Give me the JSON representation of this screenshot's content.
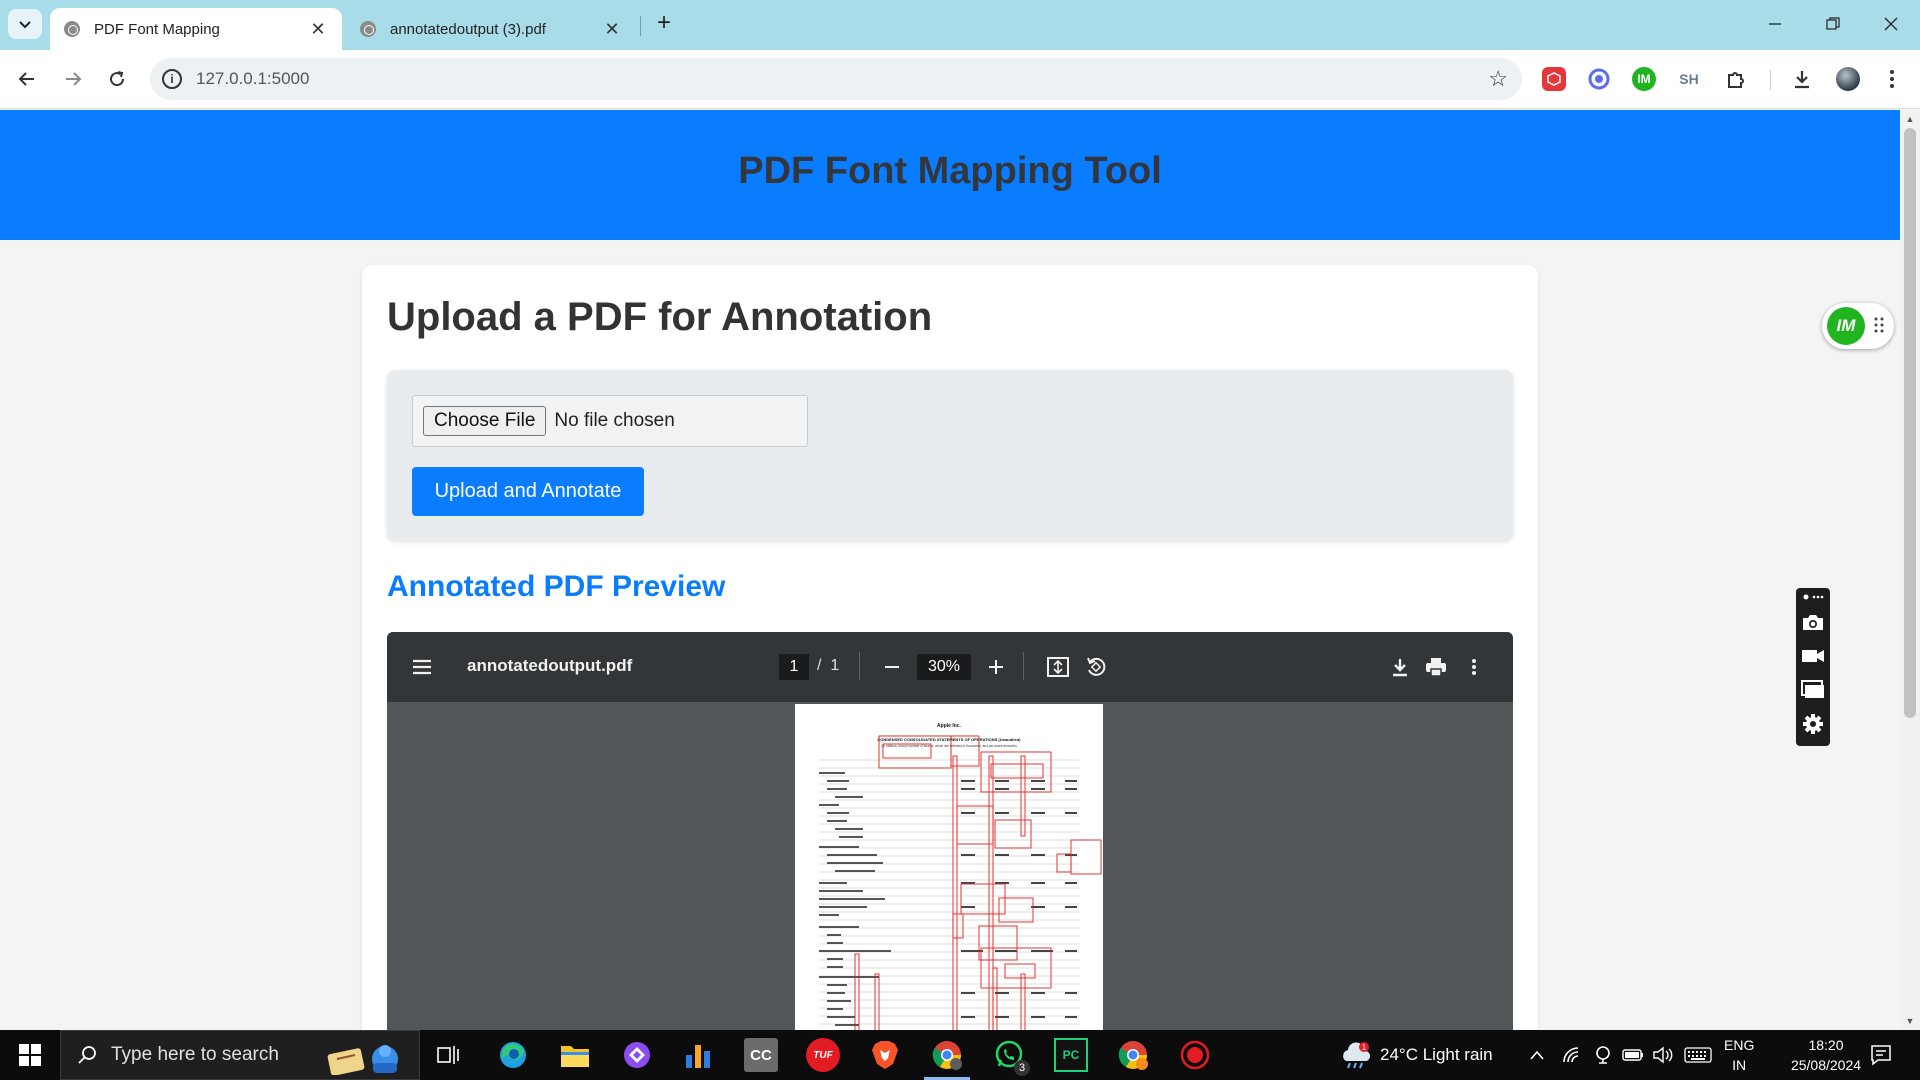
{
  "browser": {
    "tabs": [
      {
        "title": "PDF Font Mapping",
        "active": true
      },
      {
        "title": "annotatedoutput (3).pdf",
        "active": false
      }
    ],
    "url": "127.0.0.1:5000",
    "extensions": [
      {
        "name": "red-cube-extension-icon",
        "color": "#e5373b"
      },
      {
        "name": "blue-swirl-extension-icon",
        "color": "#5b6cf0"
      },
      {
        "name": "im-extension-icon",
        "label": "IM",
        "color": "#21b421"
      },
      {
        "name": "sh-extension-icon",
        "label": "SH",
        "color": "#6b7c93"
      }
    ]
  },
  "page": {
    "header_title": "PDF Font Mapping Tool",
    "upload_heading": "Upload a PDF for Annotation",
    "choose_file_label": "Choose File",
    "file_status": "No file chosen",
    "submit_label": "Upload and Annotate",
    "preview_heading": "Annotated PDF Preview"
  },
  "pdf_viewer": {
    "filename": "annotatedoutput.pdf",
    "current_page": "1",
    "page_separator": "/",
    "total_pages": "1",
    "zoom": "30%"
  },
  "pdf_document": {
    "company": "Apple Inc.",
    "statement_title": "CONDENSED CONSOLIDATED STATEMENTS OF OPERATIONS (Unaudited)",
    "statement_subtitle": "(In millions, except number of shares, which are reflected in thousands, and per-share amounts)"
  },
  "side_tools": {
    "im_badge_label": "IM"
  },
  "taskbar": {
    "search_placeholder": "Type here to search",
    "weather": "24°C  Light rain",
    "language": "ENG",
    "region": "IN",
    "time": "18:20",
    "date": "25/08/2024",
    "whatsapp_badge": "3",
    "notification_count": "1",
    "app_labels": {
      "cc": "CC",
      "tuf": "TUF",
      "pc": "PC"
    }
  },
  "colors": {
    "brand_blue": "#0a7cff",
    "tabstrip": "#a8dce9",
    "annotation_red": "#e02020"
  }
}
